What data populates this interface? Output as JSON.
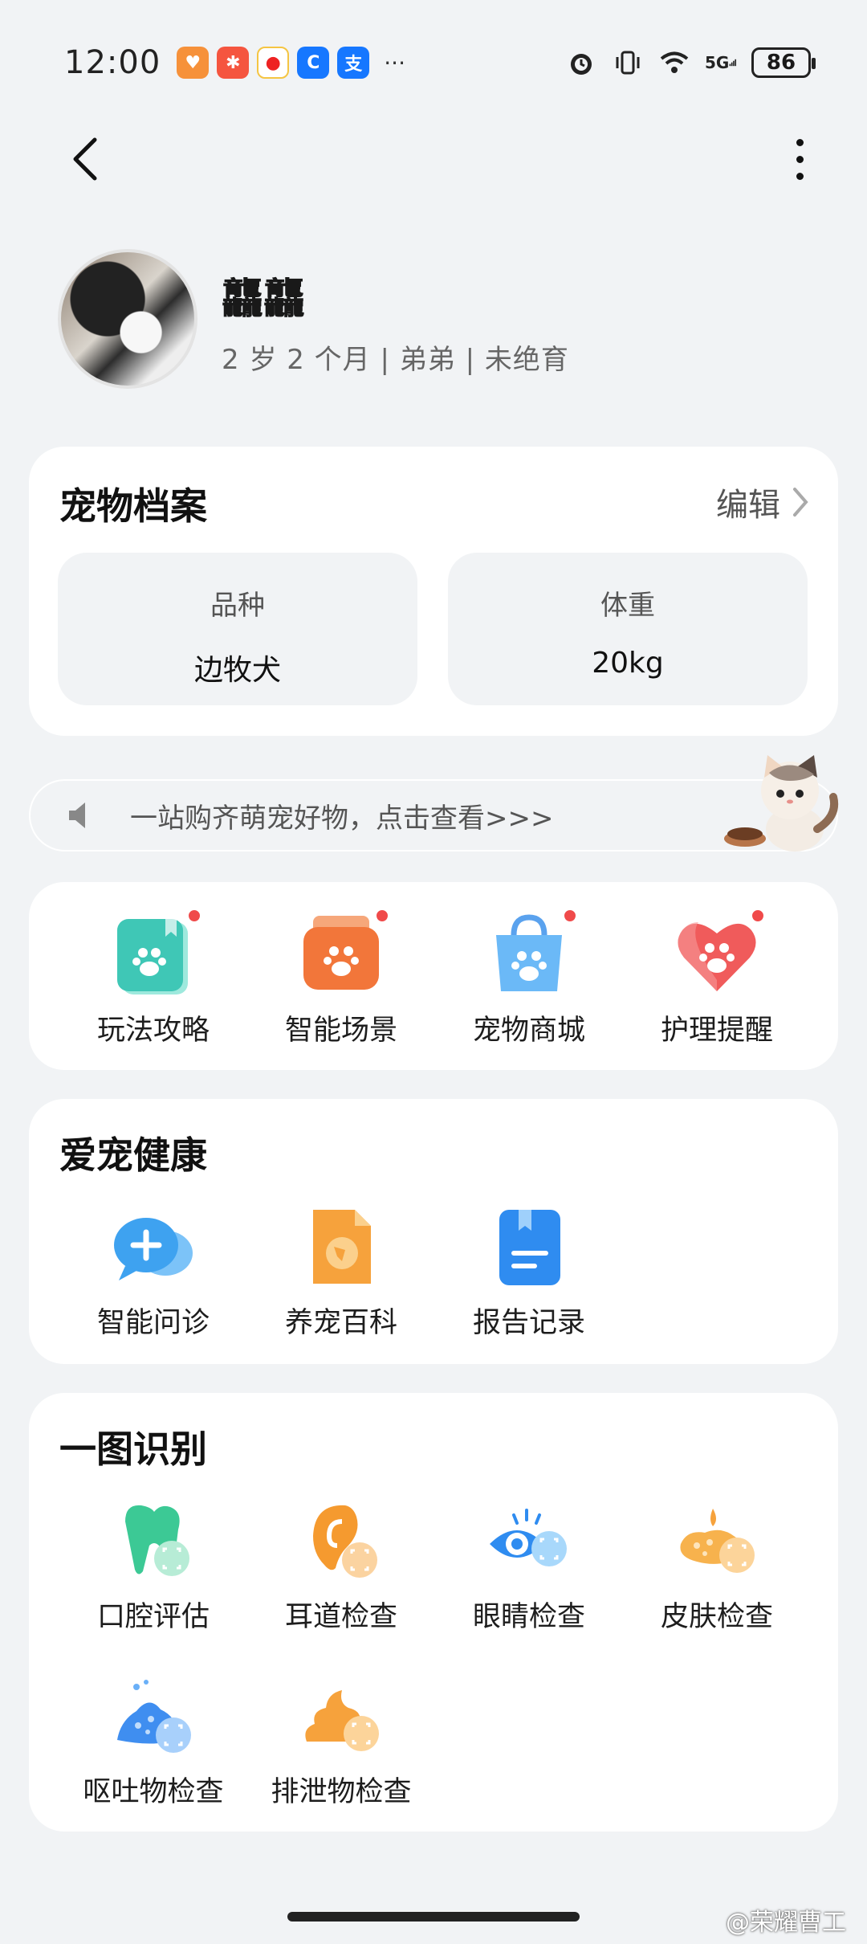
{
  "status_bar": {
    "time": "12:00",
    "battery": "86",
    "network": "5G",
    "notification_icons": [
      "health-icon",
      "app-icon",
      "weibo-icon",
      "chat-icon",
      "alipay-icon"
    ],
    "overflow": "···"
  },
  "profile": {
    "name": "龘龘",
    "meta": "2 岁 2 个月 | 弟弟 | 未绝育"
  },
  "archive": {
    "title": "宠物档案",
    "edit_label": "编辑",
    "fields": [
      {
        "label": "品种",
        "value": "边牧犬"
      },
      {
        "label": "体重",
        "value": "20kg"
      }
    ]
  },
  "banner": {
    "text": "一站购齐萌宠好物，点击查看>>>"
  },
  "shortcuts": [
    {
      "label": "玩法攻略",
      "icon": "guide-icon",
      "color": "#4fd1c5"
    },
    {
      "label": "智能场景",
      "icon": "scene-icon",
      "color": "#f57c3a"
    },
    {
      "label": "宠物商城",
      "icon": "shop-icon",
      "color": "#53a8f5"
    },
    {
      "label": "护理提醒",
      "icon": "care-icon",
      "color": "#f25a5a"
    }
  ],
  "health": {
    "title": "爱宠健康",
    "items": [
      {
        "label": "智能问诊",
        "icon": "consult-icon"
      },
      {
        "label": "养宠百科",
        "icon": "encyclopedia-icon"
      },
      {
        "label": "报告记录",
        "icon": "report-icon"
      }
    ]
  },
  "recognition": {
    "title": "一图识别",
    "items": [
      {
        "label": "口腔评估",
        "icon": "tooth-icon"
      },
      {
        "label": "耳道检查",
        "icon": "ear-icon"
      },
      {
        "label": "眼睛检查",
        "icon": "eye-icon"
      },
      {
        "label": "皮肤检查",
        "icon": "skin-icon"
      },
      {
        "label": "呕吐物检查",
        "icon": "vomit-icon"
      },
      {
        "label": "排泄物检查",
        "icon": "feces-icon"
      }
    ]
  },
  "watermark": "@荣耀曹工"
}
